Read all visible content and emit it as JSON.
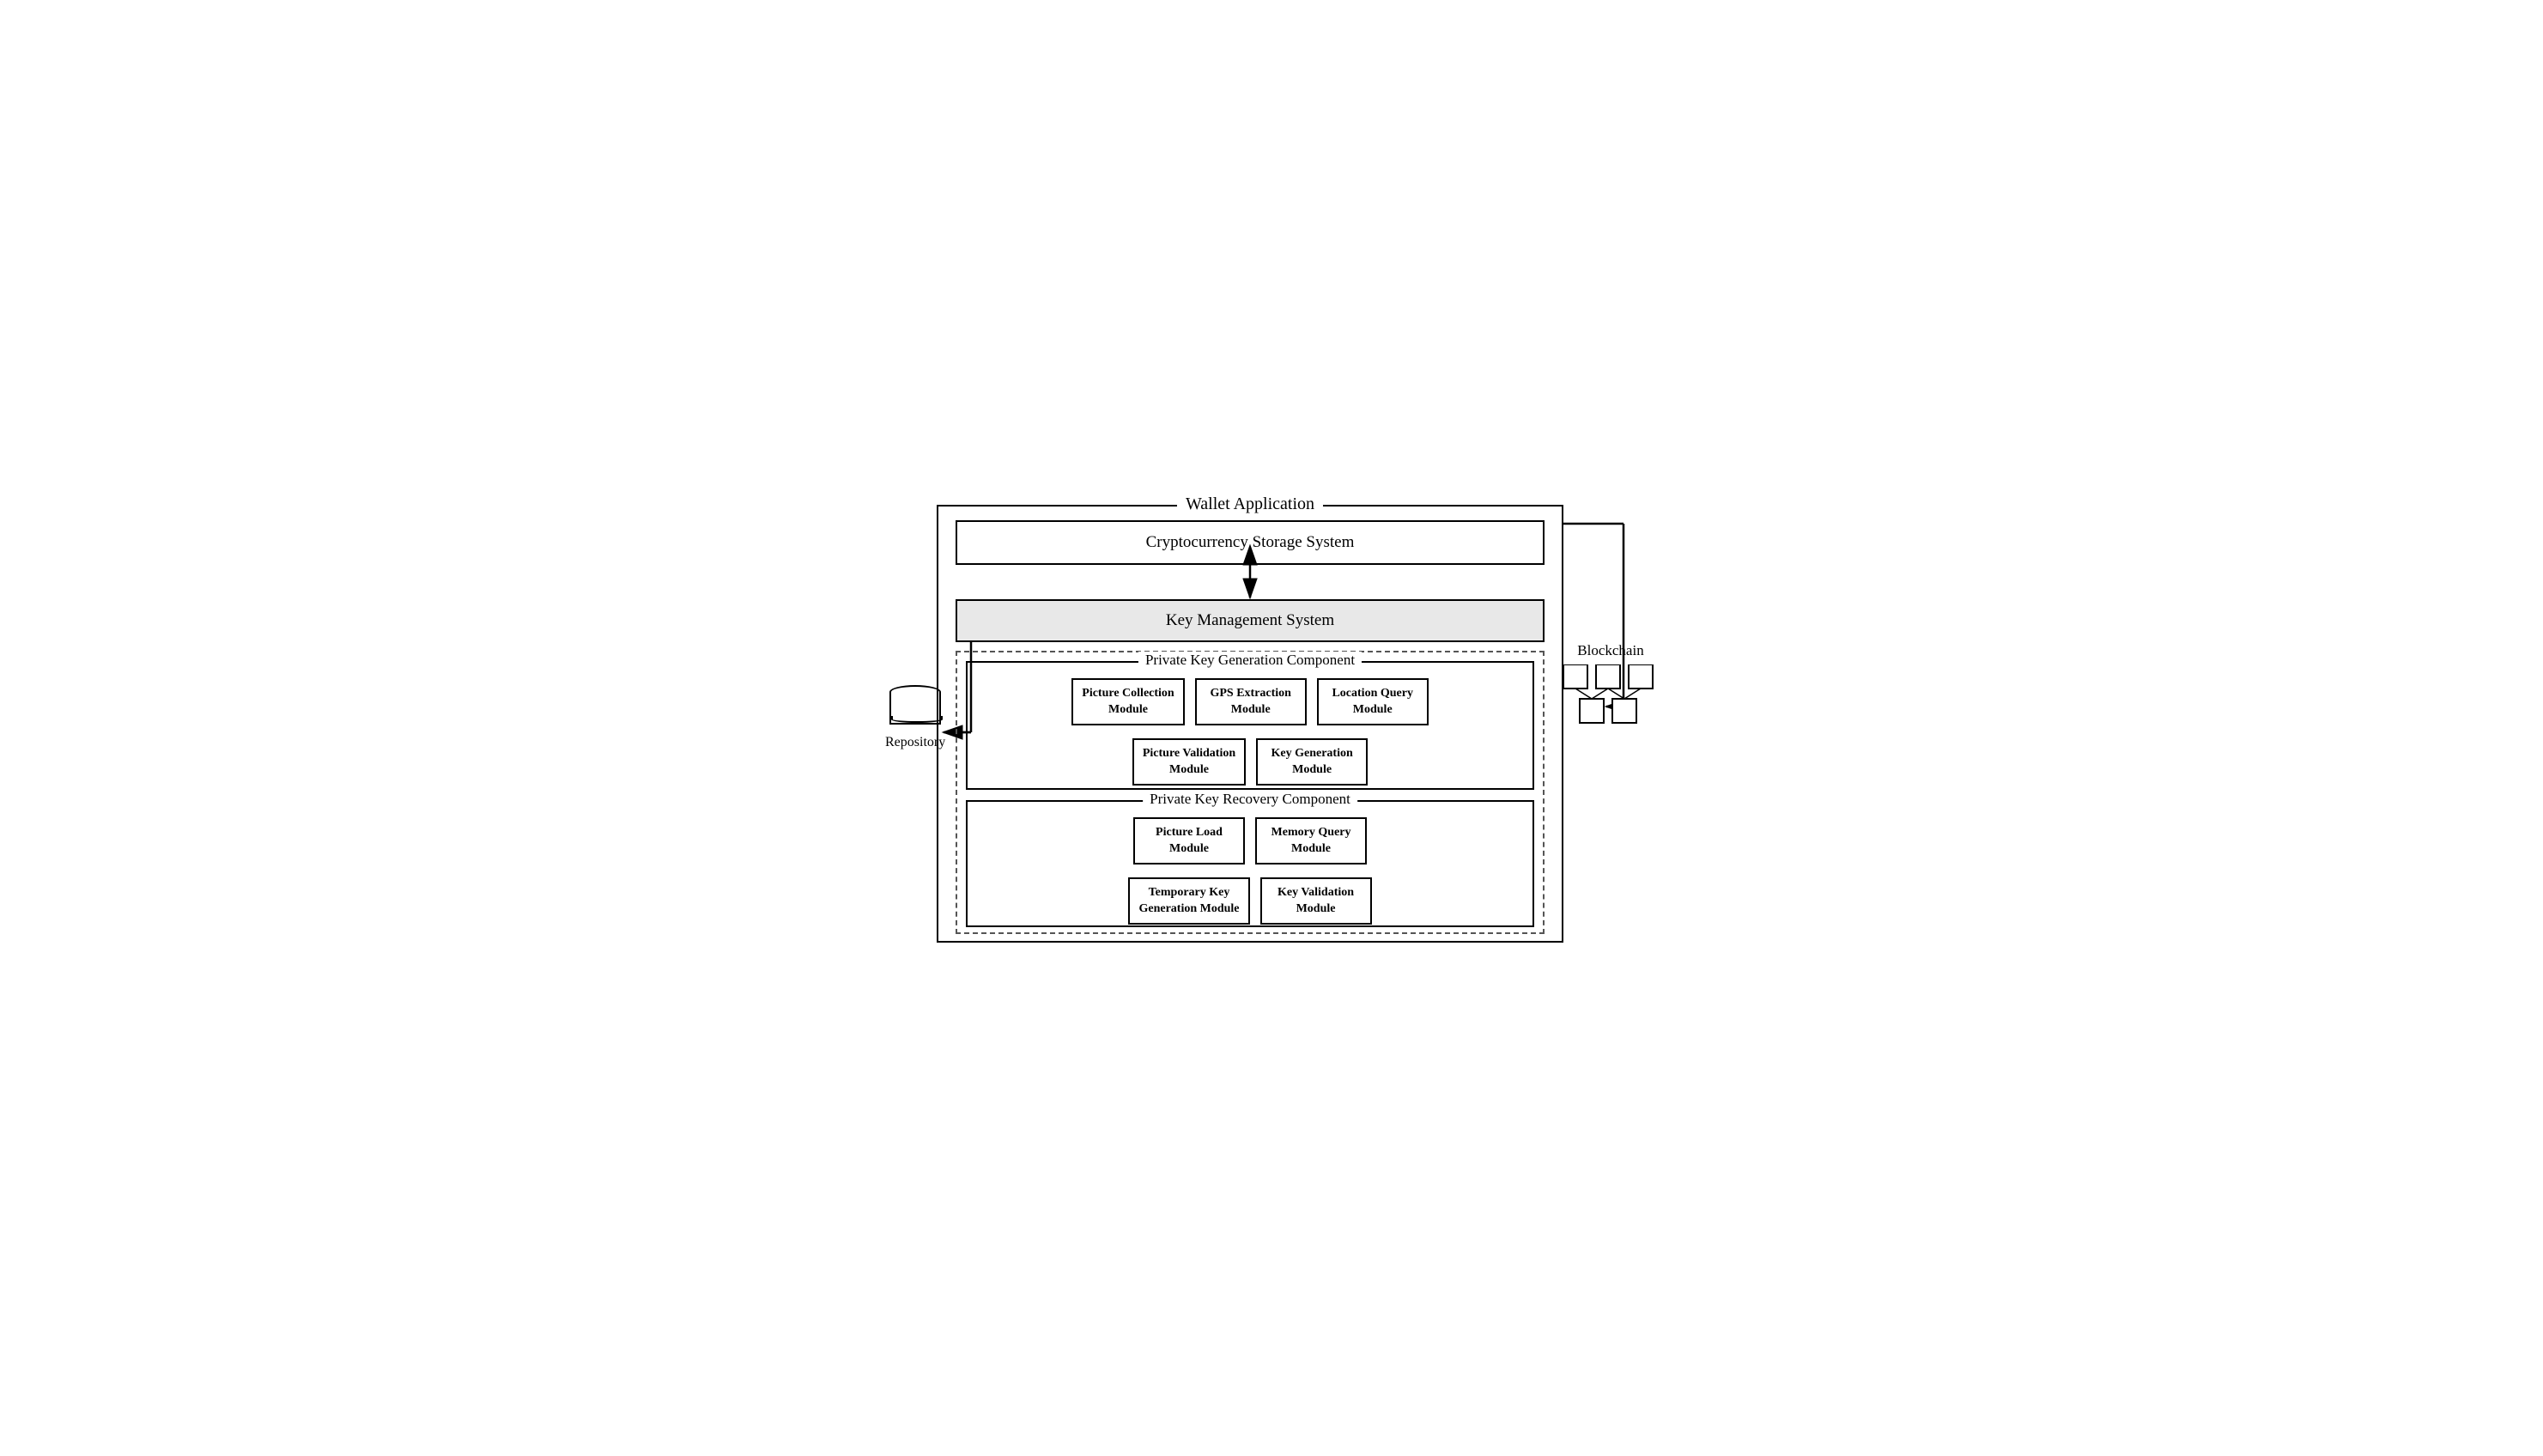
{
  "title": "Wallet Application",
  "css": {
    "label": "Cryptocurrency Storage System"
  },
  "kms": {
    "label": "Key Management System"
  },
  "pkgc": {
    "label": "Private Key Generation Component",
    "row1": [
      {
        "text": "Picture Collection\nModule"
      },
      {
        "text": "GPS Extraction\nModule"
      },
      {
        "text": "Location Query\nModule"
      }
    ],
    "row2": [
      {
        "text": "Picture Validation\nModule"
      },
      {
        "text": "Key Generation\nModule"
      }
    ]
  },
  "pkrc": {
    "label": "Private Key Recovery Component",
    "row1": [
      {
        "text": "Picture Load\nModule"
      },
      {
        "text": "Memory Query\nModule"
      }
    ],
    "row2": [
      {
        "text": "Temporary Key\nGeneration Module"
      },
      {
        "text": "Key Validation\nModule"
      }
    ]
  },
  "repository": {
    "label": "Repository"
  },
  "blockchain": {
    "label": "Blockchain"
  }
}
